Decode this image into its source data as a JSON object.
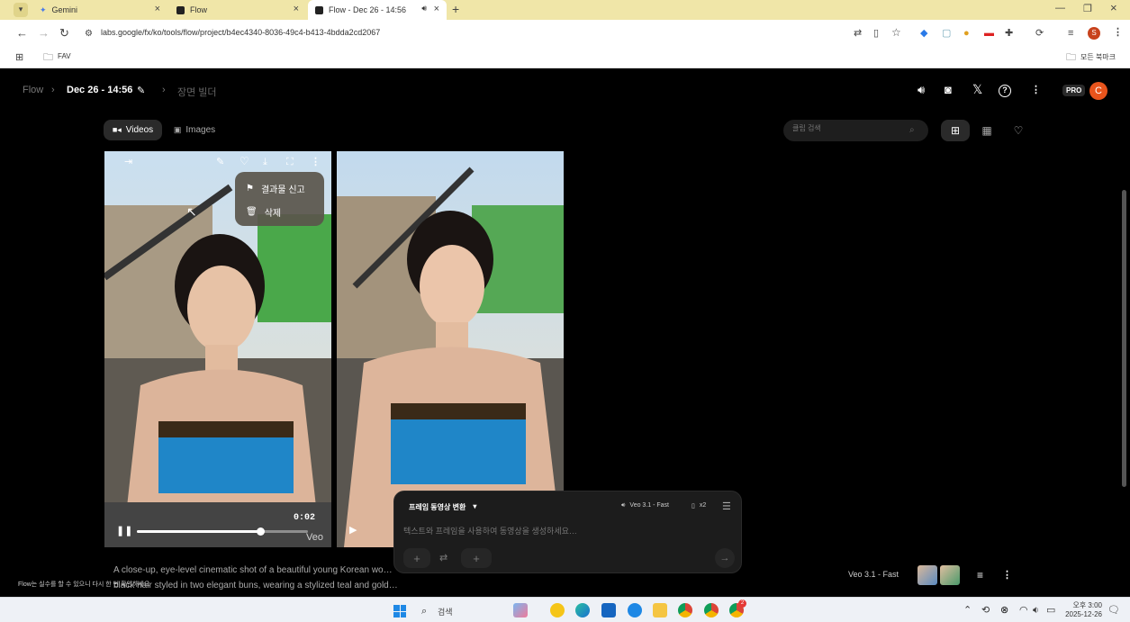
{
  "browser": {
    "tabs": [
      {
        "title": "Gemini",
        "icon": "gemini-icon"
      },
      {
        "title": "Flow",
        "icon": "flow-icon"
      },
      {
        "title": "Flow - Dec 26 - 14:56",
        "icon": "flow-icon",
        "active": true
      }
    ],
    "url": "labs.google/fx/ko/tools/flow/project/b4ec4340-8036-49c4-b413-4bdda2cd2067",
    "bookmarks": {
      "folder": "FAV",
      "all_bookmarks": "모든 북마크"
    },
    "profile_initial": "S"
  },
  "app": {
    "breadcrumb": {
      "root": "Flow",
      "project": "Dec 26 - 14:56",
      "scene_builder": "장면 빌더"
    },
    "plan_badge": "PRO",
    "avatar_initial": "C",
    "filters": {
      "videos": "Videos",
      "images": "Images"
    },
    "search": {
      "placeholder": "클립 검색"
    },
    "context_menu": {
      "report": "결과물 신고",
      "delete": "삭제"
    },
    "player": {
      "timestamp": "0:02",
      "watermark": "Veo",
      "progress_fraction": 0.72
    },
    "caption": "A close-up, eye-level cinematic shot of a beautiful young Korean wo… black hair styled in two elegant buns, wearing a stylized teal and gold…",
    "footer_note": "Flow는 실수를 할 수 있으니 다시 한 번 확인하세요",
    "composer": {
      "mode": "프레임 동영상 변환",
      "model": "Veo 3.1 - Fast",
      "count": "x2",
      "placeholder": "텍스트와 프레임을 사용하여 동영상을 생성하세요…"
    },
    "bottom_model": "Veo 3.1 - Fast"
  },
  "taskbar": {
    "search": "검색",
    "time": "오후 3:00",
    "date": "2025-12-26",
    "chrome_badge": "2"
  },
  "colors": {
    "accent_orange": "#e8541c",
    "tab_bar": "#f0e6a8"
  }
}
